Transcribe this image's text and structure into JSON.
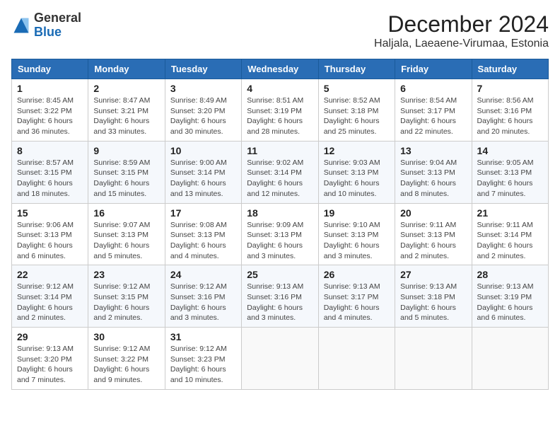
{
  "header": {
    "logo_general": "General",
    "logo_blue": "Blue",
    "month_title": "December 2024",
    "location": "Haljala, Laeaene-Virumaa, Estonia"
  },
  "days_of_week": [
    "Sunday",
    "Monday",
    "Tuesday",
    "Wednesday",
    "Thursday",
    "Friday",
    "Saturday"
  ],
  "weeks": [
    [
      {
        "day": "1",
        "sunrise": "Sunrise: 8:45 AM",
        "sunset": "Sunset: 3:22 PM",
        "daylight": "Daylight: 6 hours and 36 minutes."
      },
      {
        "day": "2",
        "sunrise": "Sunrise: 8:47 AM",
        "sunset": "Sunset: 3:21 PM",
        "daylight": "Daylight: 6 hours and 33 minutes."
      },
      {
        "day": "3",
        "sunrise": "Sunrise: 8:49 AM",
        "sunset": "Sunset: 3:20 PM",
        "daylight": "Daylight: 6 hours and 30 minutes."
      },
      {
        "day": "4",
        "sunrise": "Sunrise: 8:51 AM",
        "sunset": "Sunset: 3:19 PM",
        "daylight": "Daylight: 6 hours and 28 minutes."
      },
      {
        "day": "5",
        "sunrise": "Sunrise: 8:52 AM",
        "sunset": "Sunset: 3:18 PM",
        "daylight": "Daylight: 6 hours and 25 minutes."
      },
      {
        "day": "6",
        "sunrise": "Sunrise: 8:54 AM",
        "sunset": "Sunset: 3:17 PM",
        "daylight": "Daylight: 6 hours and 22 minutes."
      },
      {
        "day": "7",
        "sunrise": "Sunrise: 8:56 AM",
        "sunset": "Sunset: 3:16 PM",
        "daylight": "Daylight: 6 hours and 20 minutes."
      }
    ],
    [
      {
        "day": "8",
        "sunrise": "Sunrise: 8:57 AM",
        "sunset": "Sunset: 3:15 PM",
        "daylight": "Daylight: 6 hours and 18 minutes."
      },
      {
        "day": "9",
        "sunrise": "Sunrise: 8:59 AM",
        "sunset": "Sunset: 3:15 PM",
        "daylight": "Daylight: 6 hours and 15 minutes."
      },
      {
        "day": "10",
        "sunrise": "Sunrise: 9:00 AM",
        "sunset": "Sunset: 3:14 PM",
        "daylight": "Daylight: 6 hours and 13 minutes."
      },
      {
        "day": "11",
        "sunrise": "Sunrise: 9:02 AM",
        "sunset": "Sunset: 3:14 PM",
        "daylight": "Daylight: 6 hours and 12 minutes."
      },
      {
        "day": "12",
        "sunrise": "Sunrise: 9:03 AM",
        "sunset": "Sunset: 3:13 PM",
        "daylight": "Daylight: 6 hours and 10 minutes."
      },
      {
        "day": "13",
        "sunrise": "Sunrise: 9:04 AM",
        "sunset": "Sunset: 3:13 PM",
        "daylight": "Daylight: 6 hours and 8 minutes."
      },
      {
        "day": "14",
        "sunrise": "Sunrise: 9:05 AM",
        "sunset": "Sunset: 3:13 PM",
        "daylight": "Daylight: 6 hours and 7 minutes."
      }
    ],
    [
      {
        "day": "15",
        "sunrise": "Sunrise: 9:06 AM",
        "sunset": "Sunset: 3:13 PM",
        "daylight": "Daylight: 6 hours and 6 minutes."
      },
      {
        "day": "16",
        "sunrise": "Sunrise: 9:07 AM",
        "sunset": "Sunset: 3:13 PM",
        "daylight": "Daylight: 6 hours and 5 minutes."
      },
      {
        "day": "17",
        "sunrise": "Sunrise: 9:08 AM",
        "sunset": "Sunset: 3:13 PM",
        "daylight": "Daylight: 6 hours and 4 minutes."
      },
      {
        "day": "18",
        "sunrise": "Sunrise: 9:09 AM",
        "sunset": "Sunset: 3:13 PM",
        "daylight": "Daylight: 6 hours and 3 minutes."
      },
      {
        "day": "19",
        "sunrise": "Sunrise: 9:10 AM",
        "sunset": "Sunset: 3:13 PM",
        "daylight": "Daylight: 6 hours and 3 minutes."
      },
      {
        "day": "20",
        "sunrise": "Sunrise: 9:11 AM",
        "sunset": "Sunset: 3:13 PM",
        "daylight": "Daylight: 6 hours and 2 minutes."
      },
      {
        "day": "21",
        "sunrise": "Sunrise: 9:11 AM",
        "sunset": "Sunset: 3:14 PM",
        "daylight": "Daylight: 6 hours and 2 minutes."
      }
    ],
    [
      {
        "day": "22",
        "sunrise": "Sunrise: 9:12 AM",
        "sunset": "Sunset: 3:14 PM",
        "daylight": "Daylight: 6 hours and 2 minutes."
      },
      {
        "day": "23",
        "sunrise": "Sunrise: 9:12 AM",
        "sunset": "Sunset: 3:15 PM",
        "daylight": "Daylight: 6 hours and 2 minutes."
      },
      {
        "day": "24",
        "sunrise": "Sunrise: 9:12 AM",
        "sunset": "Sunset: 3:16 PM",
        "daylight": "Daylight: 6 hours and 3 minutes."
      },
      {
        "day": "25",
        "sunrise": "Sunrise: 9:13 AM",
        "sunset": "Sunset: 3:16 PM",
        "daylight": "Daylight: 6 hours and 3 minutes."
      },
      {
        "day": "26",
        "sunrise": "Sunrise: 9:13 AM",
        "sunset": "Sunset: 3:17 PM",
        "daylight": "Daylight: 6 hours and 4 minutes."
      },
      {
        "day": "27",
        "sunrise": "Sunrise: 9:13 AM",
        "sunset": "Sunset: 3:18 PM",
        "daylight": "Daylight: 6 hours and 5 minutes."
      },
      {
        "day": "28",
        "sunrise": "Sunrise: 9:13 AM",
        "sunset": "Sunset: 3:19 PM",
        "daylight": "Daylight: 6 hours and 6 minutes."
      }
    ],
    [
      {
        "day": "29",
        "sunrise": "Sunrise: 9:13 AM",
        "sunset": "Sunset: 3:20 PM",
        "daylight": "Daylight: 6 hours and 7 minutes."
      },
      {
        "day": "30",
        "sunrise": "Sunrise: 9:12 AM",
        "sunset": "Sunset: 3:22 PM",
        "daylight": "Daylight: 6 hours and 9 minutes."
      },
      {
        "day": "31",
        "sunrise": "Sunrise: 9:12 AM",
        "sunset": "Sunset: 3:23 PM",
        "daylight": "Daylight: 6 hours and 10 minutes."
      },
      null,
      null,
      null,
      null
    ]
  ]
}
